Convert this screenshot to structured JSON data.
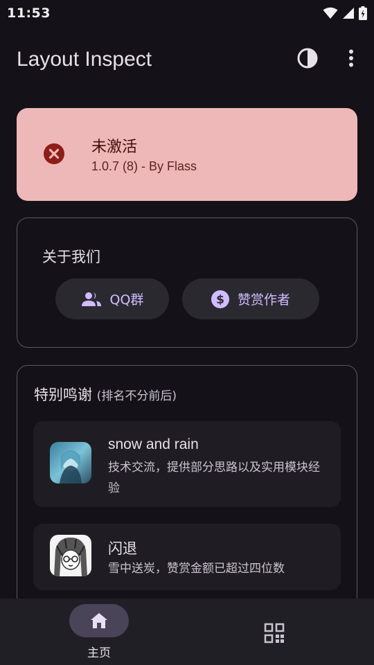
{
  "status_bar": {
    "time": "11:53"
  },
  "appbar": {
    "title": "Layout Inspect",
    "theme_icon": "contrast-icon",
    "more_icon": "more-vert-icon"
  },
  "status_card": {
    "title": "未激活",
    "version": "1.0.7 (8) - By Flass",
    "icon": "close-circle-icon",
    "bg_color": "#efb8b8"
  },
  "about": {
    "title": "关于我们",
    "qq_label": "QQ群",
    "donate_label": "赞赏作者"
  },
  "thanks": {
    "title": "特别鸣谢",
    "subtitle": "(排名不分前后)",
    "people": [
      {
        "name": "snow and rain",
        "desc": "技术交流，提供部分思路以及实用模块经验"
      },
      {
        "name": "闪退",
        "desc": "雪中送炭，赞赏金额已超过四位数"
      }
    ]
  },
  "bottom_nav": {
    "home_label": "主页",
    "home_icon": "home-icon",
    "apps_icon": "apps-grid-icon"
  },
  "colors": {
    "accent": "#d0bcff",
    "background": "#141218"
  }
}
